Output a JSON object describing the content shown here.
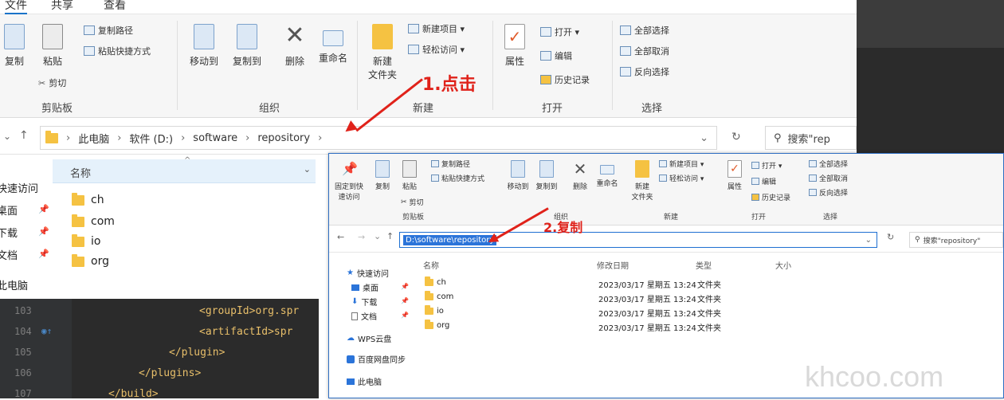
{
  "window1": {
    "tabs": [
      "文件",
      "共享",
      "查看"
    ],
    "ribbon": {
      "clipboard_group": {
        "label": "剪贴板",
        "buttons": [
          {
            "label": "复制",
            "icon": "copy-icon"
          },
          {
            "label": "粘贴",
            "icon": "paste-icon"
          }
        ],
        "small": [
          "复制路径",
          "粘贴快捷方式",
          "剪切"
        ]
      },
      "organize_group": {
        "label": "组织",
        "buttons": [
          {
            "label": "移动到",
            "icon": "move-to-icon"
          },
          {
            "label": "复制到",
            "icon": "copy-to-icon"
          },
          {
            "label": "删除",
            "icon": "delete-icon"
          },
          {
            "label": "重命名",
            "icon": "rename-icon"
          }
        ]
      },
      "new_group": {
        "label": "新建",
        "buttons": [
          {
            "label": "新建\n文件夹",
            "icon": "new-folder-icon"
          }
        ],
        "small": [
          "新建项目 ▾",
          "轻松访问 ▾"
        ]
      },
      "open_group": {
        "label": "打开",
        "buttons": [
          {
            "label": "属性",
            "icon": "properties-icon"
          }
        ],
        "small": [
          "打开 ▾",
          "编辑",
          "历史记录"
        ]
      },
      "select_group": {
        "label": "选择",
        "small": [
          "全部选择",
          "全部取消",
          "反向选择"
        ]
      }
    },
    "address": {
      "breadcrumbs": [
        "此电脑",
        "软件 (D:)",
        "software",
        "repository"
      ],
      "search_placeholder": "搜索\"rep"
    },
    "nav": [
      "快速访问",
      "桌面",
      "下载",
      "文档",
      "此电脑"
    ],
    "column_header": "名称",
    "files": [
      "ch",
      "com",
      "io",
      "org"
    ]
  },
  "code": {
    "lines": [
      {
        "num": "103",
        "indent": "          ",
        "content": "<groupId>org.spr"
      },
      {
        "num": "104",
        "indent": "          ",
        "content": "<artifactId>spr"
      },
      {
        "num": "105",
        "indent": "        ",
        "content": "</plugin>"
      },
      {
        "num": "106",
        "indent": "      ",
        "content": "</plugins>"
      },
      {
        "num": "107",
        "indent": "    ",
        "content": "</build>"
      }
    ]
  },
  "window2": {
    "ribbon_labels": {
      "pin": "固定到快\n速访问",
      "copy": "复制",
      "paste": "粘贴",
      "clipboard": "剪贴板",
      "small_clip": [
        "复制路径",
        "粘贴快捷方式",
        "剪切"
      ],
      "move": "移动到",
      "copyto": "复制到",
      "delete": "删除",
      "rename": "重命名",
      "organize": "组织",
      "newfolder": "新建\n文件夹",
      "new_small": [
        "新建项目 ▾",
        "轻松访问 ▾"
      ],
      "new": "新建",
      "props": "属性",
      "open_small": [
        "打开 ▾",
        "编辑",
        "历史记录"
      ],
      "open": "打开",
      "select_small": [
        "全部选择",
        "全部取消",
        "反向选择"
      ],
      "select": "选择"
    },
    "address_value": "D:\\software\\repository",
    "search_placeholder": "搜索\"repository\"",
    "nav": [
      "快速访问",
      "桌面",
      "下载",
      "文档",
      "WPS云盘",
      "百度网盘同步",
      "此电脑"
    ],
    "headers": [
      "名称",
      "修改日期",
      "类型",
      "大小"
    ],
    "rows": [
      {
        "name": "ch",
        "date": "2023/03/17 星期五 13:24",
        "type": "文件夹"
      },
      {
        "name": "com",
        "date": "2023/03/17 星期五 13:24",
        "type": "文件夹"
      },
      {
        "name": "io",
        "date": "2023/03/17 星期五 13:24",
        "type": "文件夹"
      },
      {
        "name": "org",
        "date": "2023/03/17 星期五 13:24",
        "type": "文件夹"
      }
    ]
  },
  "annotations": {
    "step1": "1.点击",
    "step2": "2.复制"
  },
  "watermark": "khcoo.com",
  "colors": {
    "accent": "#1a73c9",
    "annotation": "#e0221a",
    "folder": "#f5c242"
  }
}
